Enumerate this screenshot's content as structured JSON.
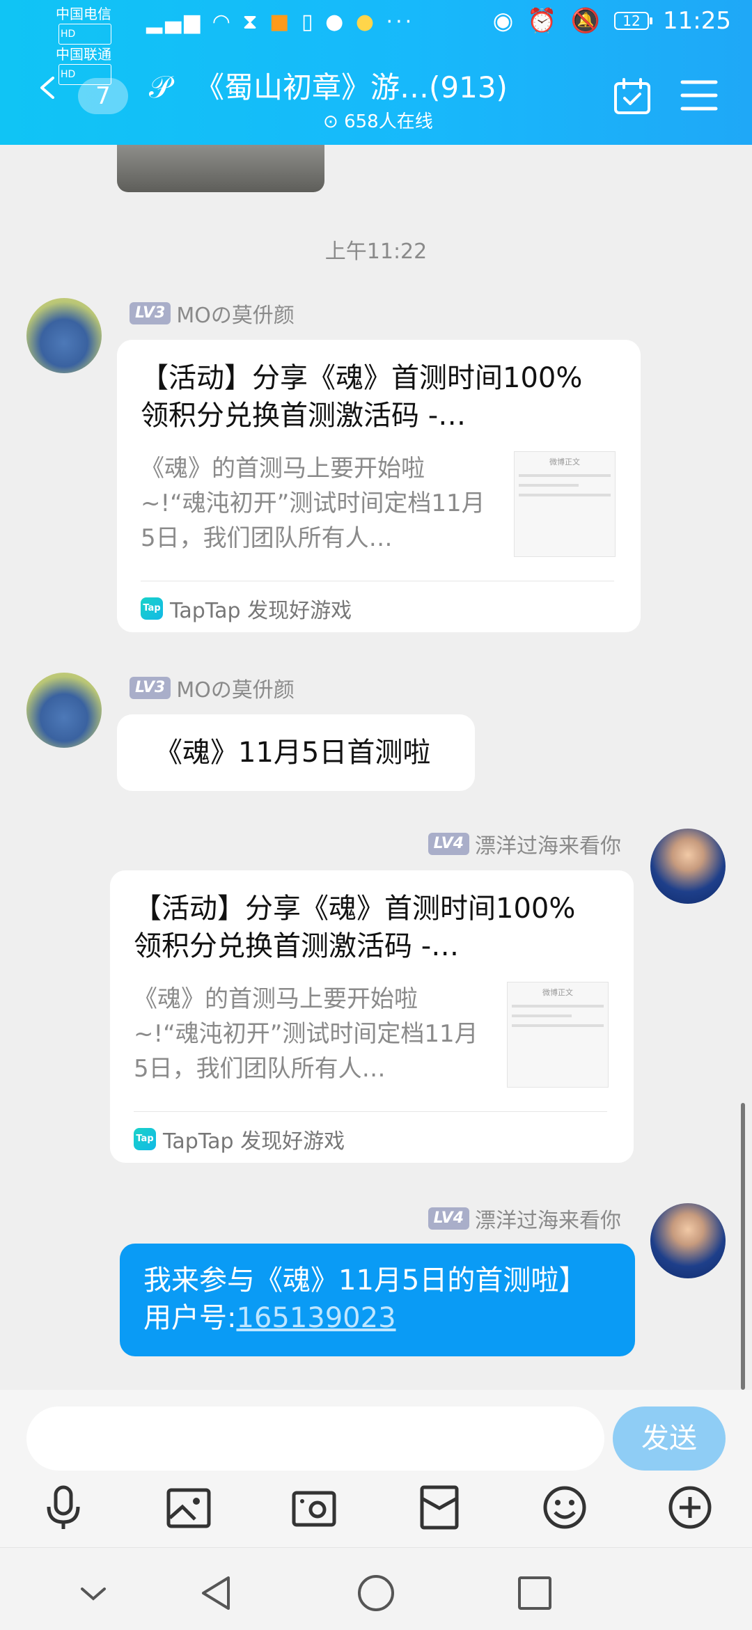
{
  "status_bar": {
    "carrier1": "中国电信",
    "carrier2": "中国联通",
    "hd": "HD",
    "battery": "12",
    "time": "11:25"
  },
  "header": {
    "unread_count": "7",
    "title": "《蜀山初章》游…(913)",
    "online": "658人在线"
  },
  "chat": {
    "time_separator": "上午11:22",
    "messages": [
      {
        "level": "LV3",
        "sender": "MOの莫㐼颜",
        "card": {
          "title": "【活动】分享《魂》首测时间100%领积分兑换首测激活码 -…",
          "desc": "《魂》的首测马上要开始啦~!“魂沌初开”测试时间定档11月5日，我们团队所有人…",
          "thumb_title": "微博正文",
          "source": "TapTap 发现好游戏"
        }
      },
      {
        "level": "LV3",
        "sender": "MOの莫㐼颜",
        "text": "《魂》11月5日首测啦"
      },
      {
        "level": "LV4",
        "sender": "漂洋过海来看你",
        "card": {
          "title": "【活动】分享《魂》首测时间100%领积分兑换首测激活码 -…",
          "desc": "《魂》的首测马上要开始啦~!“魂沌初开”测试时间定档11月5日，我们团队所有人…",
          "thumb_title": "微博正文",
          "source": "TapTap 发现好游戏"
        }
      },
      {
        "level": "LV4",
        "sender": "漂洋过海来看你",
        "text_prefix": "我来参与《魂》11月5日的首测啦】 用户号:",
        "user_id": "165139023"
      }
    ]
  },
  "input": {
    "placeholder": "",
    "send_label": "发送"
  },
  "icons": {
    "tap_logo": "Tap"
  }
}
